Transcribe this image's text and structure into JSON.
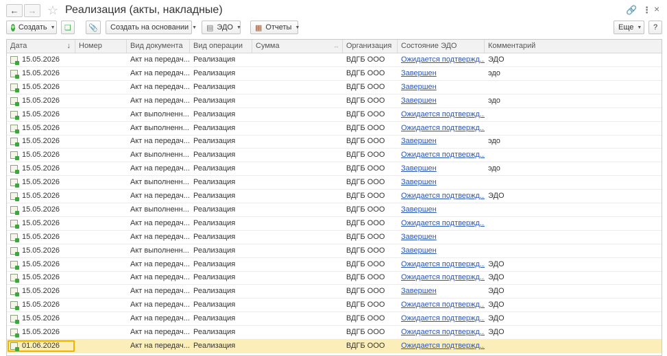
{
  "window": {
    "title": "Реализация (акты, накладные)"
  },
  "toolbar": {
    "create": "Создать",
    "create_based": "Создать на основании",
    "edo": "ЭДО",
    "reports": "Отчеты",
    "more": "Еще",
    "help": "?"
  },
  "columns": [
    "Дата",
    "Номер",
    "Вид документа",
    "Вид операции",
    "Сумма",
    "Организация",
    "Состояние ЭДО",
    "Комментарий"
  ],
  "rows": [
    {
      "date": "15.05.2026",
      "doc": "Акт на передач...",
      "op": "Реализация",
      "org": "ВДГБ ООО",
      "edo": "Ожидается подтвержд...",
      "comment": "ЭДО"
    },
    {
      "date": "15.05.2026",
      "doc": "Акт на передач...",
      "op": "Реализация",
      "org": "ВДГБ ООО",
      "edo": "Завершен",
      "comment": "эдо"
    },
    {
      "date": "15.05.2026",
      "doc": "Акт на передач...",
      "op": "Реализация",
      "org": "ВДГБ ООО",
      "edo": "Завершен",
      "comment": ""
    },
    {
      "date": "15.05.2026",
      "doc": "Акт на передач...",
      "op": "Реализация",
      "org": "ВДГБ ООО",
      "edo": "Завершен",
      "comment": "эдо"
    },
    {
      "date": "15.05.2026",
      "doc": "Акт выполненн...",
      "op": "Реализация",
      "org": "ВДГБ ООО",
      "edo": "Ожидается подтвержд...",
      "comment": ""
    },
    {
      "date": "15.05.2026",
      "doc": "Акт выполненн...",
      "op": "Реализация",
      "org": "ВДГБ ООО",
      "edo": "Ожидается подтвержд...",
      "comment": ""
    },
    {
      "date": "15.05.2026",
      "doc": "Акт на передач...",
      "op": "Реализация",
      "org": "ВДГБ ООО",
      "edo": "Завершен",
      "comment": "эдо"
    },
    {
      "date": "15.05.2026",
      "doc": "Акт выполненн...",
      "op": "Реализация",
      "org": "ВДГБ ООО",
      "edo": "Ожидается подтвержд...",
      "comment": ""
    },
    {
      "date": "15.05.2026",
      "doc": "Акт на передач...",
      "op": "Реализация",
      "org": "ВДГБ ООО",
      "edo": "Завершен",
      "comment": "эдо"
    },
    {
      "date": "15.05.2026",
      "doc": "Акт выполненн...",
      "op": "Реализация",
      "org": "ВДГБ ООО",
      "edo": "Завершен",
      "comment": ""
    },
    {
      "date": "15.05.2026",
      "doc": "Акт на передач...",
      "op": "Реализация",
      "org": "ВДГБ ООО",
      "edo": "Ожидается подтвержд...",
      "comment": "ЭДО"
    },
    {
      "date": "15.05.2026",
      "doc": "Акт выполненн...",
      "op": "Реализация",
      "org": "ВДГБ ООО",
      "edo": "Завершен",
      "comment": ""
    },
    {
      "date": "15.05.2026",
      "doc": "Акт на передач...",
      "op": "Реализация",
      "org": "ВДГБ ООО",
      "edo": "Ожидается подтвержд...",
      "comment": ""
    },
    {
      "date": "15.05.2026",
      "doc": "Акт на передач...",
      "op": "Реализация",
      "org": "ВДГБ ООО",
      "edo": "Завершен",
      "comment": ""
    },
    {
      "date": "15.05.2026",
      "doc": "Акт выполненн...",
      "op": "Реализация",
      "org": "ВДГБ ООО",
      "edo": "Завершен",
      "comment": ""
    },
    {
      "date": "15.05.2026",
      "doc": "Акт на передач...",
      "op": "Реализация",
      "org": "ВДГБ ООО",
      "edo": "Ожидается подтвержд...",
      "comment": "ЭДО"
    },
    {
      "date": "15.05.2026",
      "doc": "Акт на передач...",
      "op": "Реализация",
      "org": "ВДГБ ООО",
      "edo": "Ожидается подтвержд...",
      "comment": "ЭДО"
    },
    {
      "date": "15.05.2026",
      "doc": "Акт на передач...",
      "op": "Реализация",
      "org": "ВДГБ ООО",
      "edo": "Завершен",
      "comment": "ЭДО"
    },
    {
      "date": "15.05.2026",
      "doc": "Акт на передач...",
      "op": "Реализация",
      "org": "ВДГБ ООО",
      "edo": "Ожидается подтвержд...",
      "comment": "ЭДО"
    },
    {
      "date": "15.05.2026",
      "doc": "Акт на передач...",
      "op": "Реализация",
      "org": "ВДГБ ООО",
      "edo": "Ожидается подтвержд...",
      "comment": "ЭДО"
    },
    {
      "date": "15.05.2026",
      "doc": "Акт на передач...",
      "op": "Реализация",
      "org": "ВДГБ ООО",
      "edo": "Ожидается подтвержд...",
      "comment": "ЭДО"
    },
    {
      "date": "01.06.2026",
      "doc": "Акт на передач...",
      "op": "Реализация",
      "org": "ВДГБ ООО",
      "edo": "Ожидается подтвержд...",
      "comment": ""
    }
  ],
  "colors": {
    "link": "#2a56b8",
    "selected_row": "#fbeeb8",
    "selection_border": "#f0b400",
    "accent_green": "#3aa83a"
  }
}
